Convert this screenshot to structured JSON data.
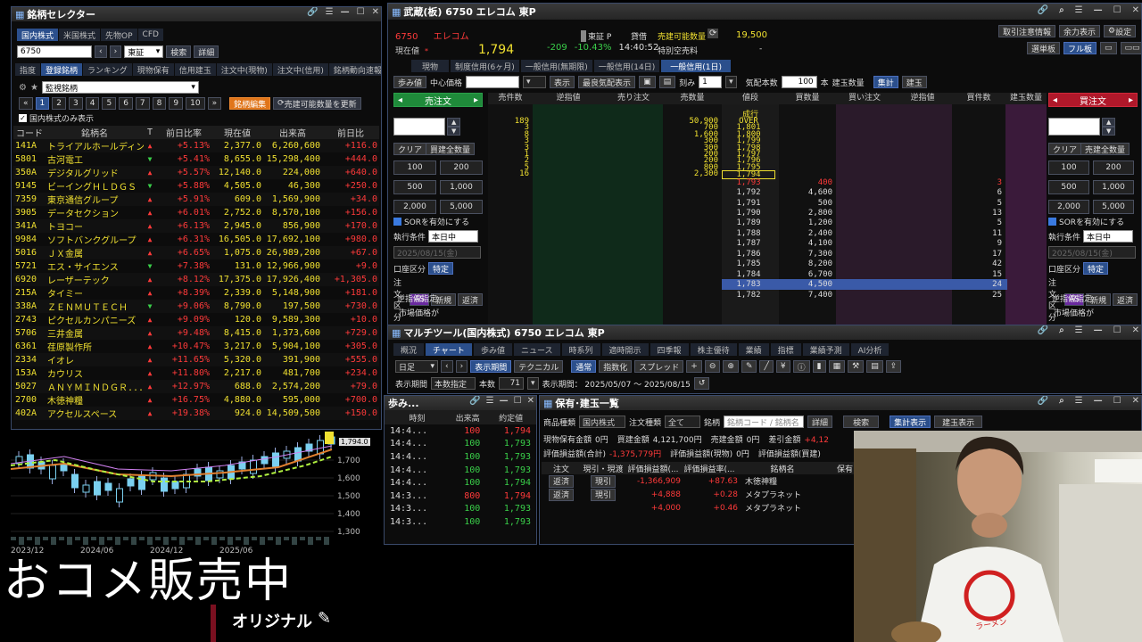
{
  "selector": {
    "title": "銘柄セレクター",
    "market_tabs": [
      "国内株式",
      "米国株式",
      "先物OP",
      "CFD"
    ],
    "code": "6750",
    "exchange": "東証",
    "search_btn": "検索",
    "detail_btn": "詳細",
    "nav_tabs": [
      "指度",
      "登録銘柄",
      "ランキング",
      "現物保有",
      "信用建玉",
      "注文中(現物)",
      "注文中(信用)",
      "銘柄動向速報"
    ],
    "list_name": "監視銘柄",
    "pages": [
      "1",
      "2",
      "3",
      "4",
      "5",
      "6",
      "7",
      "8",
      "9",
      "10"
    ],
    "edit_btn": "銘柄編集",
    "refresh_btn": "売建可能数量を更新",
    "domestic_only": "国内株式のみ表示",
    "columns": [
      "コード",
      "銘柄名",
      "T",
      "前日比率",
      "現在値",
      "出来高",
      "前日比"
    ],
    "rows": [
      {
        "code": "141A",
        "name": "トライアルホールディングス",
        "t": "▲",
        "pct": "+5.13%",
        "price": "2,377.0",
        "vol": "6,260,600",
        "chg": "+116.0",
        "dir": "up"
      },
      {
        "code": "5801",
        "name": "古河電工",
        "t": "▼",
        "pct": "+5.41%",
        "price": "8,655.0",
        "vol": "15,298,400",
        "chg": "+444.0",
        "dir": "down"
      },
      {
        "code": "350A",
        "name": "デジタルグリッド",
        "t": "▲",
        "pct": "+5.57%",
        "price": "12,140.0",
        "vol": "224,000",
        "chg": "+640.0",
        "dir": "up"
      },
      {
        "code": "9145",
        "name": "ビーイングＨＬＤＧＳ",
        "t": "▼",
        "pct": "+5.88%",
        "price": "4,505.0",
        "vol": "46,300",
        "chg": "+250.0",
        "dir": "down"
      },
      {
        "code": "7359",
        "name": "東京通信グループ",
        "t": "▲",
        "pct": "+5.91%",
        "price": "609.0",
        "vol": "1,569,900",
        "chg": "+34.0",
        "dir": "up"
      },
      {
        "code": "3905",
        "name": "データセクション",
        "t": "▲",
        "pct": "+6.01%",
        "price": "2,752.0",
        "vol": "8,570,100",
        "chg": "+156.0",
        "dir": "up"
      },
      {
        "code": "341A",
        "name": "トヨコー",
        "t": "▲",
        "pct": "+6.13%",
        "price": "2,945.0",
        "vol": "856,900",
        "chg": "+170.0",
        "dir": "up"
      },
      {
        "code": "9984",
        "name": "ソフトバンクグループ",
        "t": "▲",
        "pct": "+6.31%",
        "price": "16,505.0",
        "vol": "17,692,100",
        "chg": "+980.0",
        "dir": "up"
      },
      {
        "code": "5016",
        "name": "ＪＸ金属",
        "t": "▲",
        "pct": "+6.65%",
        "price": "1,075.0",
        "vol": "26,989,200",
        "chg": "+67.0",
        "dir": "up"
      },
      {
        "code": "5721",
        "name": "エス・サイエンス",
        "t": "▼",
        "pct": "+7.38%",
        "price": "131.0",
        "vol": "12,966,900",
        "chg": "+9.0",
        "dir": "down"
      },
      {
        "code": "6920",
        "name": "レーザーテック",
        "t": "▲",
        "pct": "+8.12%",
        "price": "17,375.0",
        "vol": "17,926,400",
        "chg": "+1,305.0",
        "dir": "up"
      },
      {
        "code": "215A",
        "name": "タイミー",
        "t": "▲",
        "pct": "+8.39%",
        "price": "2,339.0",
        "vol": "5,148,900",
        "chg": "+181.0",
        "dir": "up"
      },
      {
        "code": "338A",
        "name": "ＺＥＮＭＵＴＥＣＨ",
        "t": "▼",
        "pct": "+9.06%",
        "price": "8,790.0",
        "vol": "197,500",
        "chg": "+730.0",
        "dir": "down"
      },
      {
        "code": "2743",
        "name": "ピクセルカンパニーズ",
        "t": "▲",
        "pct": "+9.09%",
        "price": "120.0",
        "vol": "9,589,300",
        "chg": "+10.0",
        "dir": "up"
      },
      {
        "code": "5706",
        "name": "三井金属",
        "t": "▲",
        "pct": "+9.48%",
        "price": "8,415.0",
        "vol": "1,373,600",
        "chg": "+729.0",
        "dir": "up"
      },
      {
        "code": "6361",
        "name": "荏原製作所",
        "t": "▲",
        "pct": "+10.47%",
        "price": "3,217.0",
        "vol": "5,904,100",
        "chg": "+305.0",
        "dir": "up"
      },
      {
        "code": "2334",
        "name": "イオレ",
        "t": "▲",
        "pct": "+11.65%",
        "price": "5,320.0",
        "vol": "391,900",
        "chg": "+555.0",
        "dir": "up"
      },
      {
        "code": "153A",
        "name": "カウリス",
        "t": "▲",
        "pct": "+11.80%",
        "price": "2,217.0",
        "vol": "481,700",
        "chg": "+234.0",
        "dir": "up"
      },
      {
        "code": "5027",
        "name": "ＡＮＹＭＩＮＤＧＲ...",
        "t": "▲",
        "pct": "+12.97%",
        "price": "688.0",
        "vol": "2,574,200",
        "chg": "+79.0",
        "dir": "up"
      },
      {
        "code": "2700",
        "name": "木徳神糧",
        "t": "▲",
        "pct": "+16.75%",
        "price": "4,880.0",
        "vol": "595,000",
        "chg": "+700.0",
        "dir": "up"
      },
      {
        "code": "402A",
        "name": "アクセルスペース",
        "t": "▲",
        "pct": "+19.38%",
        "price": "924.0",
        "vol": "14,509,500",
        "chg": "+150.0",
        "dir": "up"
      }
    ]
  },
  "minichart": {
    "last_price": "1,794.0",
    "yticks": [
      "1,700",
      "1,600",
      "1,500",
      "1,400",
      "1,300"
    ],
    "xticks": [
      "2023/12",
      "2024/06",
      "2024/12",
      "2025/06"
    ]
  },
  "board": {
    "title": "武蔵(板) 6750 エレコム 東P",
    "code": "6750",
    "name": "エレコム",
    "market": "東証 P",
    "price_label": "現在値",
    "price": "1,794",
    "change": "-209",
    "change_pct": "-10.43%",
    "time": "14:40:52",
    "lend_label": "貸借",
    "sellable_label": "売建可能数量",
    "sellable": "19,500",
    "special_label": "特別空売料",
    "special": "-",
    "top_btns": [
      "取引注意情報",
      "余力表示",
      "設定"
    ],
    "sub_btns": [
      "選単板",
      "フル板"
    ],
    "tabs": [
      "現物",
      "制度信用(6ヶ月)",
      "一般信用(無期限)",
      "一般信用(14日)",
      "一般信用(1日)"
    ],
    "toolbar": [
      "歩み値",
      "中心価格",
      "表示",
      "最良気配表示",
      "刻み",
      "気配本数",
      "本",
      "建玉数量",
      "集計",
      "建玉"
    ],
    "tick_value": "1",
    "rows_value": "100",
    "sell_btn": "売注文",
    "buy_btn": "買注文",
    "columns": [
      "売件数",
      "逆指値",
      "売り注文",
      "売数量",
      "値段",
      "買数量",
      "買い注文",
      "逆指値",
      "買件数",
      "建玉数量"
    ],
    "asks": [
      {
        "cnt": "189",
        "qty": "50,900",
        "price": "OVER"
      },
      {
        "cnt": "3",
        "qty": "700",
        "price": "1,801"
      },
      {
        "cnt": "8",
        "qty": "1,600",
        "price": "1,800"
      },
      {
        "cnt": "3",
        "qty": "300",
        "price": "1,799"
      },
      {
        "cnt": "3",
        "qty": "300",
        "price": "1,798"
      },
      {
        "cnt": "1",
        "qty": "200",
        "price": "1,797"
      },
      {
        "cnt": "2",
        "qty": "200",
        "price": "1,796"
      },
      {
        "cnt": "5",
        "qty": "800",
        "price": "1,795"
      },
      {
        "cnt": "16",
        "qty": "2,300",
        "price": "1,794"
      }
    ],
    "bids": [
      {
        "price": "1,793",
        "qty": "400",
        "cnt": "3"
      },
      {
        "price": "1,792",
        "qty": "4,600",
        "cnt": "6"
      },
      {
        "price": "1,791",
        "qty": "500",
        "cnt": "5"
      },
      {
        "price": "1,790",
        "qty": "2,800",
        "cnt": "13"
      },
      {
        "price": "1,789",
        "qty": "1,200",
        "cnt": "5"
      },
      {
        "price": "1,788",
        "qty": "2,400",
        "cnt": "11"
      },
      {
        "price": "1,787",
        "qty": "4,100",
        "cnt": "9"
      },
      {
        "price": "1,786",
        "qty": "7,300",
        "cnt": "17"
      },
      {
        "price": "1,785",
        "qty": "8,200",
        "cnt": "42"
      },
      {
        "price": "1,784",
        "qty": "6,700",
        "cnt": "15"
      },
      {
        "price": "1,783",
        "qty": "4,500",
        "cnt": "24"
      },
      {
        "price": "1,782",
        "qty": "7,400",
        "cnt": "25"
      }
    ],
    "market_label": "成行",
    "side_clear": "クリア",
    "side_all_sell": "買建全数量",
    "side_all_buy": "売建全数量",
    "qty_btns": [
      "100",
      "200",
      "500",
      "1,000",
      "2,000",
      "5,000"
    ],
    "sor_label": "SORを有効にする",
    "exec_label": "執行条件",
    "exec_value": "本日中",
    "date_value": "2025/08/15(金)",
    "account_label": "口座区分",
    "account_value": "特定",
    "order_type_label": "注文区分",
    "order_types": [
      "AS",
      "新規",
      "返済"
    ],
    "stop_label": "逆指値指定",
    "market_price_label": "市場価格が"
  },
  "multitool": {
    "title": "マルチツール(国内株式) 6750 エレコム 東P",
    "tabs": [
      "概況",
      "チャート",
      "歩み値",
      "ニュース",
      "時系列",
      "適時開示",
      "四季報",
      "株主優待",
      "業績",
      "指標",
      "業績予測",
      "AI分析"
    ],
    "period": "日足",
    "btns": [
      "表示期間",
      "テクニカル",
      "通常",
      "指数化",
      "スプレッド"
    ],
    "period_label": "表示期間",
    "period_value": "本数指定",
    "count_label": "本数",
    "count_value": "71",
    "date_range": "表示期間： 2025/05/07 ～ 2025/08/15"
  },
  "ticks": {
    "title": "歩み...",
    "columns": [
      "時刻",
      "出来高",
      "約定値"
    ],
    "rows": [
      {
        "t": "14:4...",
        "v": "100",
        "p": "1,794",
        "c": "red"
      },
      {
        "t": "14:4...",
        "v": "100",
        "p": "1,793",
        "c": "green"
      },
      {
        "t": "14:4...",
        "v": "100",
        "p": "1,793",
        "c": "green"
      },
      {
        "t": "14:4...",
        "v": "100",
        "p": "1,793",
        "c": "green"
      },
      {
        "t": "14:4...",
        "v": "100",
        "p": "1,794",
        "c": "green"
      },
      {
        "t": "14:3...",
        "v": "800",
        "p": "1,794",
        "c": "red"
      },
      {
        "t": "14:3...",
        "v": "100",
        "p": "1,793",
        "c": "green"
      },
      {
        "t": "14:3...",
        "v": "100",
        "p": "1,793",
        "c": "green"
      }
    ]
  },
  "holdings": {
    "title": "保有･建玉一覧",
    "product_label": "商品種類",
    "product_value": "国内株式",
    "order_type_label": "注文種類",
    "order_type_value": "全て",
    "stock_label": "銘柄",
    "stock_placeholder": "銘柄コード / 銘柄名",
    "detail_btn": "詳細",
    "search_btn": "検索",
    "sum_btn": "集計表示",
    "pos_btn": "建玉表示",
    "summary1": [
      {
        "label": "現物保有金額",
        "value": "0円"
      },
      {
        "label": "買建金額",
        "value": "4,121,700円"
      },
      {
        "label": "売建金額",
        "value": "0円"
      },
      {
        "label": "差引金額",
        "value": "+4,12"
      }
    ],
    "summary2": [
      {
        "label": "評価損益額(合計)",
        "value": "-1,375,779円"
      },
      {
        "label": "評価損益額(現物)",
        "value": "0円"
      },
      {
        "label": "評価損益額(買建)",
        "value": ""
      }
    ],
    "columns": [
      "注文",
      "現引・現渡",
      "評価損益額(...",
      "評価損益率(...",
      "銘柄名",
      "保有"
    ],
    "rows": [
      {
        "btn1": "返済",
        "btn2": "現引",
        "pl": "-1,366,909",
        "rate": "+87.63",
        "name": "木徳神糧"
      },
      {
        "btn1": "返済",
        "btn2": "現引",
        "pl": "+4,888",
        "rate": "+0.28",
        "name": "メタプラネット"
      },
      {
        "btn1": "",
        "btn2": "",
        "pl": "+4,000",
        "rate": "+0.46",
        "name": "メタプラネット"
      }
    ]
  },
  "overlay": {
    "banner": "おコメ販売中",
    "label": "オリジナル",
    "shirt_text": "ラーメン"
  }
}
